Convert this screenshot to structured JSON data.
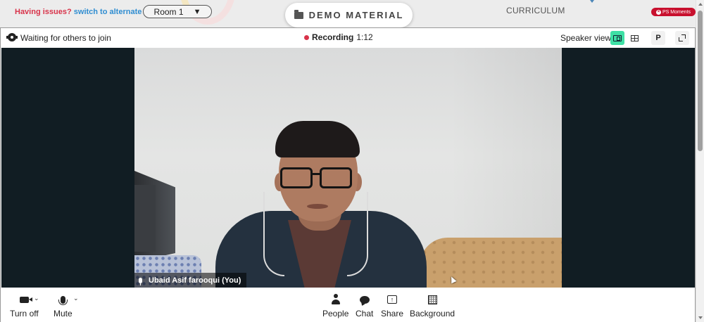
{
  "topbar": {
    "issues_text": "Having issues?",
    "alternate_link": "switch to alternate room",
    "room_value": "Room 1",
    "room_caret": "▼",
    "demo_material": "DEMO MATERIAL",
    "curriculum": "CURRICULUM",
    "ps_badge": "PS Moments",
    "ps_badge_icon": "×"
  },
  "meeting": {
    "status": "Waiting for others to join",
    "recording_label": "Recording",
    "recording_time": "1:12",
    "view_label": "Speaker view",
    "p_button": "P"
  },
  "video": {
    "participant_name": "Ubaid Asif farooqui (You)"
  },
  "toolbar": {
    "camera_label": "Turn off",
    "mute_label": "Mute",
    "chevron": "⌄",
    "people_label": "People",
    "chat_label": "Chat",
    "share_label": "Share",
    "background_label": "Background",
    "share_glyph": "↑"
  },
  "colors": {
    "accent_active": "#3ee0a5",
    "record_dot": "#d8334a",
    "link": "#2f8dd1",
    "warn": "#d8334a",
    "badge": "#c8102e"
  }
}
